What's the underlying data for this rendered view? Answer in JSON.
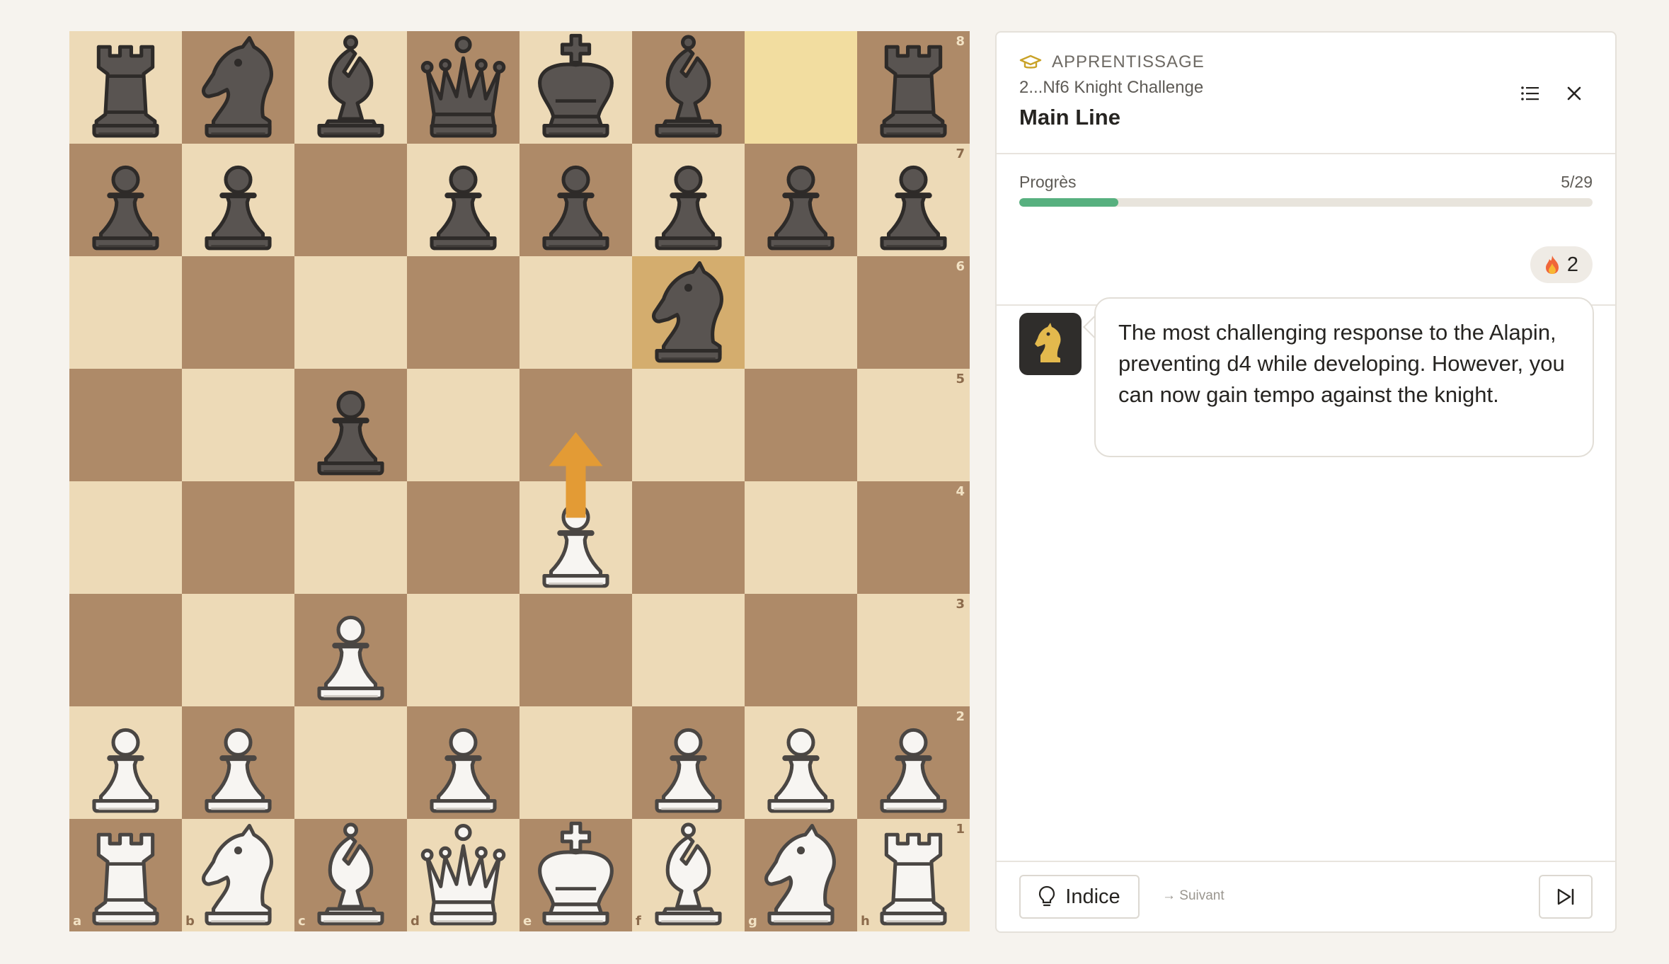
{
  "board": {
    "ranks": [
      "8",
      "7",
      "6",
      "5",
      "4",
      "3",
      "2",
      "1"
    ],
    "files": [
      "a",
      "b",
      "c",
      "d",
      "e",
      "f",
      "g",
      "h"
    ],
    "position": [
      [
        "bR",
        "bN",
        "bB",
        "bQ",
        "bK",
        "bB",
        "",
        "bR"
      ],
      [
        "bP",
        "bP",
        "",
        "bP",
        "bP",
        "bP",
        "bP",
        "bP"
      ],
      [
        "",
        "",
        "",
        "",
        "",
        "bN",
        "",
        ""
      ],
      [
        "",
        "",
        "bP",
        "",
        "",
        "",
        "",
        ""
      ],
      [
        "",
        "",
        "",
        "",
        "wP",
        "",
        "",
        ""
      ],
      [
        "",
        "",
        "wP",
        "",
        "",
        "",
        "",
        ""
      ],
      [
        "wP",
        "wP",
        "",
        "wP",
        "",
        "wP",
        "wP",
        "wP"
      ],
      [
        "wR",
        "wN",
        "wB",
        "wQ",
        "wK",
        "wB",
        "wN",
        "wR"
      ]
    ],
    "last_move": {
      "from": "g8",
      "to": "f6"
    },
    "hint_arrow": {
      "from": "e4",
      "to": "e5"
    },
    "colors": {
      "light": "#eddab7",
      "dark": "#ae8a68",
      "highlight": "#f2dda0",
      "arrow": "#e39b35"
    }
  },
  "panel": {
    "mode_icon": "graduation-cap-icon",
    "mode_label": "APPRENTISSAGE",
    "subtitle": "2...Nf6 Knight Challenge",
    "title": "Main Line",
    "progress": {
      "label": "Progrès",
      "count": "5/29",
      "fraction": 0.1724
    },
    "streak": {
      "icon": "fire-icon",
      "count": "2"
    },
    "coach": {
      "avatar_icon": "knight-icon",
      "message": "The most challenging response to the Alapin, preventing d4 while developing. However, you can now gain tempo against the knight."
    },
    "footer": {
      "hint_label": "Indice",
      "next_label": "→ Suivant",
      "skip_icon": "skip-forward-icon"
    },
    "accent_colors": {
      "progress": "#57b07f",
      "mode_icon": "#c9a227"
    }
  }
}
